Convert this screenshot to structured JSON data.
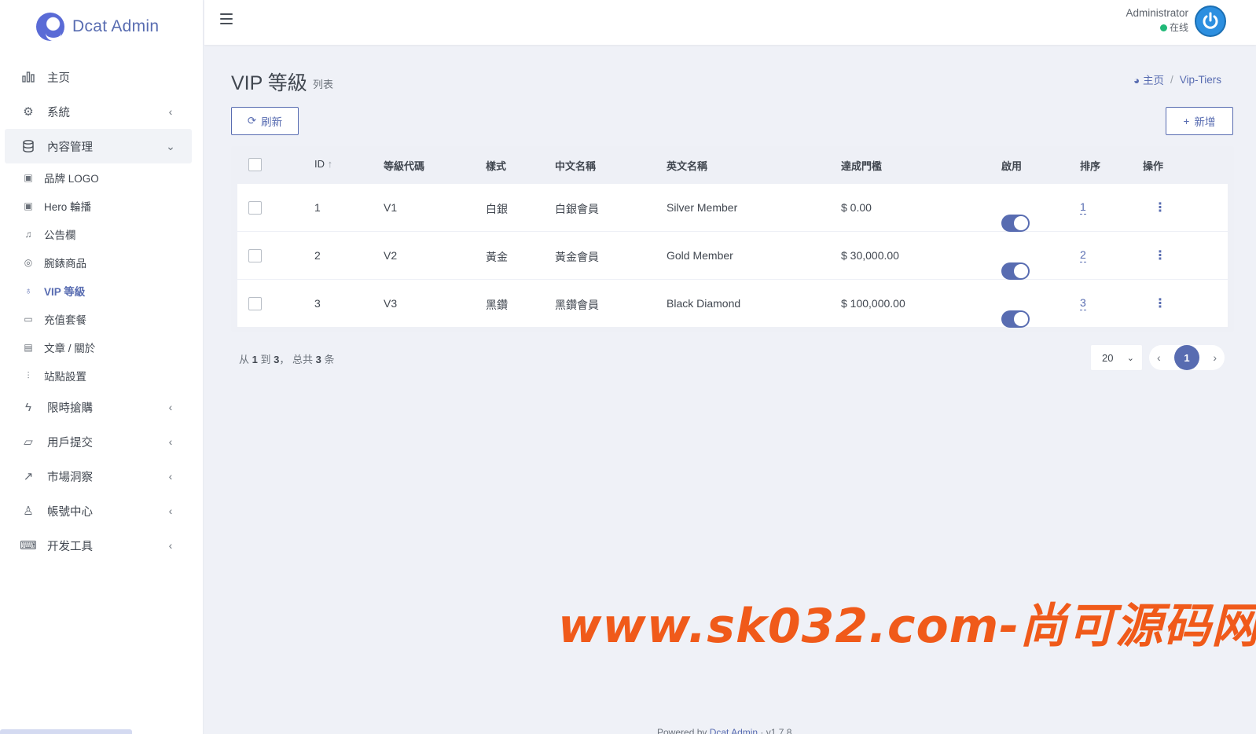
{
  "brand": {
    "name": "Dcat Admin"
  },
  "sidebar": {
    "items": [
      {
        "label": "主页",
        "icon": "bar-chart-icon",
        "arrow": ""
      },
      {
        "label": "系統",
        "icon": "gear-icon",
        "arrow": "‹"
      },
      {
        "label": "內容管理",
        "icon": "database-icon",
        "arrow": "⌄"
      },
      {
        "label": "限時搶購",
        "icon": "lightning-icon",
        "arrow": "‹"
      },
      {
        "label": "用戶提交",
        "icon": "inbox-icon",
        "arrow": "‹"
      },
      {
        "label": "市場洞察",
        "icon": "trend-up-icon",
        "arrow": "‹"
      },
      {
        "label": "帳號中心",
        "icon": "user-icon",
        "arrow": "‹"
      },
      {
        "label": "开发工具",
        "icon": "keyboard-icon",
        "arrow": "‹"
      }
    ],
    "sub_items": [
      {
        "label": "品牌 LOGO",
        "icon": "image-icon"
      },
      {
        "label": "Hero 輪播",
        "icon": "image-icon"
      },
      {
        "label": "公告欄",
        "icon": "bell-icon"
      },
      {
        "label": "腕錶商品",
        "icon": "watch-icon"
      },
      {
        "label": "VIP 等級",
        "icon": "award-icon"
      },
      {
        "label": "充值套餐",
        "icon": "credit-card-icon"
      },
      {
        "label": "文章 / 關於",
        "icon": "file-icon"
      },
      {
        "label": "站點設置",
        "icon": "sliders-icon"
      }
    ],
    "active_sub": "VIP 等級"
  },
  "topbar": {
    "user_name": "Administrator",
    "user_status": "在线",
    "status_color": "#21b978"
  },
  "header": {
    "title": "VIP 等級",
    "subtitle": "列表",
    "breadcrumb_home": "主页",
    "breadcrumb_current": "Vip-Tiers"
  },
  "toolbar": {
    "refresh_label": "刷新",
    "new_label": "新增"
  },
  "table": {
    "columns": [
      "ID",
      "等級代碼",
      "樣式",
      "中文名稱",
      "英文名稱",
      "達成門檻",
      "啟用",
      "排序",
      "操作"
    ],
    "rows": [
      {
        "id": "1",
        "code": "V1",
        "style": "白銀",
        "zh_name": "白銀會員",
        "en_name": "Silver Member",
        "threshold": "$ 0.00",
        "enabled": true,
        "order": "1"
      },
      {
        "id": "2",
        "code": "V2",
        "style": "黃金",
        "zh_name": "黃金會員",
        "en_name": "Gold Member",
        "threshold": "$ 30,000.00",
        "enabled": true,
        "order": "2"
      },
      {
        "id": "3",
        "code": "V3",
        "style": "黑鑽",
        "zh_name": "黑鑽會員",
        "en_name": "Black Diamond",
        "threshold": "$ 100,000.00",
        "enabled": true,
        "order": "3"
      }
    ]
  },
  "pagination": {
    "summary_prefix": "从",
    "from": "1",
    "summary_to": "到",
    "to": "3",
    "summary_total": "， 总共",
    "total": "3",
    "summary_suffix": "条",
    "page_size": "20",
    "current_page": "1"
  },
  "watermark": "www.sk032.com-尚可源码网",
  "footer": {
    "powered_prefix": "Powered by",
    "powered_link": "Dcat Admin",
    "version": "· v1.7.8"
  },
  "accent_color": "#586cb1"
}
